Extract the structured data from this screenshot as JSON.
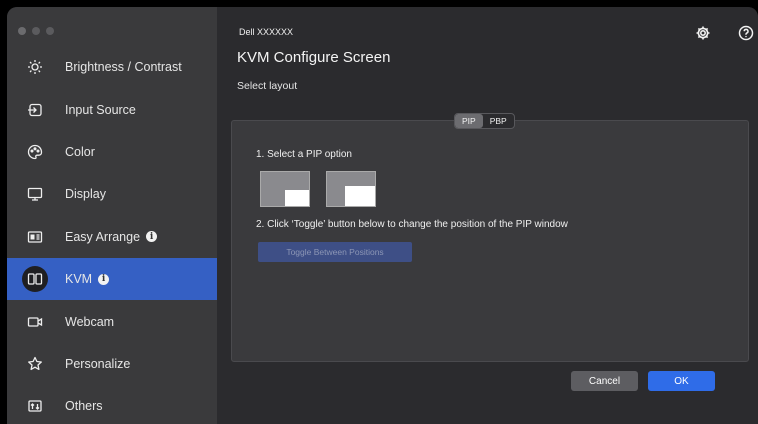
{
  "sidebar": {
    "items": [
      {
        "label": "Brightness / Contrast",
        "icon": "brightness-icon",
        "info": false,
        "active": false
      },
      {
        "label": "Input Source",
        "icon": "input-source-icon",
        "info": false,
        "active": false
      },
      {
        "label": "Color",
        "icon": "color-icon",
        "info": false,
        "active": false
      },
      {
        "label": "Display",
        "icon": "display-icon",
        "info": false,
        "active": false
      },
      {
        "label": "Easy Arrange",
        "icon": "easy-arrange-icon",
        "info": true,
        "active": false
      },
      {
        "label": "KVM",
        "icon": "kvm-icon",
        "info": true,
        "active": true
      },
      {
        "label": "Webcam",
        "icon": "webcam-icon",
        "info": false,
        "active": false
      },
      {
        "label": "Personalize",
        "icon": "star-icon",
        "info": false,
        "active": false
      },
      {
        "label": "Others",
        "icon": "others-icon",
        "info": false,
        "active": false
      }
    ]
  },
  "header": {
    "device_name": "Dell XXXXXX",
    "title": "KVM Configure Screen",
    "subtitle": "Select layout",
    "settings_icon": "gear-icon",
    "help_icon": "help-icon"
  },
  "layout_tabs": {
    "options": [
      "PIP",
      "PBP"
    ],
    "selected": "PIP"
  },
  "panel": {
    "step1": "1. Select a PIP option",
    "step2": "2. Click ‘Toggle’ button below to change the position of the PIP window",
    "toggle_label": "Toggle Between Positions"
  },
  "footer": {
    "cancel_label": "Cancel",
    "ok_label": "OK"
  },
  "colors": {
    "accent": "#3560c4",
    "ok_button": "#2f6ce8",
    "sidebar_bg": "#3a3a3c",
    "main_bg": "#2b2b2e"
  }
}
